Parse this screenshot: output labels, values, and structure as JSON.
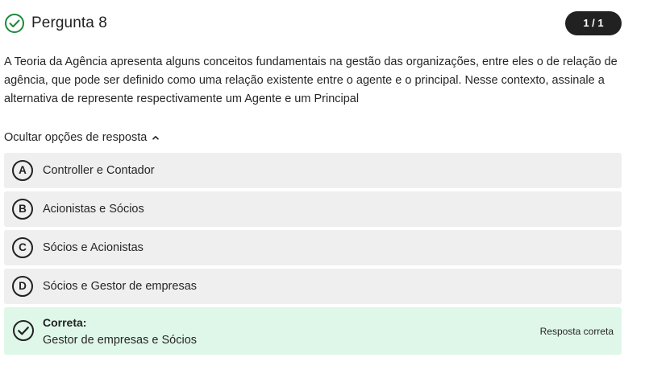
{
  "header": {
    "title": "Pergunta 8",
    "badge": "1 / 1",
    "status_color": "#1a8a3a"
  },
  "question": {
    "text": "A Teoria da Agência apresenta alguns conceitos fundamentais na gestão das organizações, entre eles o de relação de agência, que pode ser definido como uma relação existente entre o agente e o principal. Nesse contexto, assinale a alternativa de represente respectivamente um Agente e um Principal"
  },
  "toggle": {
    "label": "Ocultar opções de resposta",
    "icon": "chevron-up-icon"
  },
  "options": [
    {
      "letter": "A",
      "label": "Controller e Contador"
    },
    {
      "letter": "B",
      "label": "Acionistas e Sócios"
    },
    {
      "letter": "C",
      "label": "Sócios e Acionistas"
    },
    {
      "letter": "D",
      "label": "Sócios e Gestor de empresas"
    }
  ],
  "correct": {
    "heading": "Correta:",
    "answer": "Gestor de empresas e Sócios",
    "tag": "Resposta correta",
    "icon": "check-circle-icon",
    "background": "#dff7e9"
  }
}
